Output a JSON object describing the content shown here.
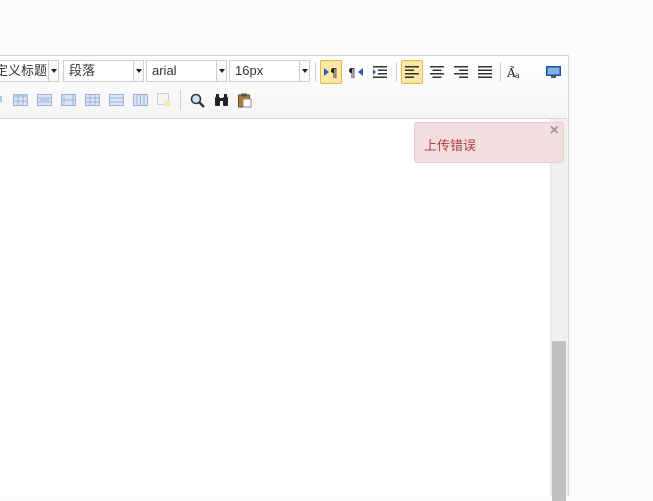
{
  "toolbar": {
    "style_select": "定义标题",
    "paragraph_select": "段落",
    "font_family_select": "arial",
    "font_size_select": "16px"
  },
  "notification": {
    "message": "上传错误",
    "close_label": "×"
  },
  "colors": {
    "active_button_bg": "#fde7a6",
    "error_bg": "#f2dede",
    "error_text": "#a94442"
  }
}
